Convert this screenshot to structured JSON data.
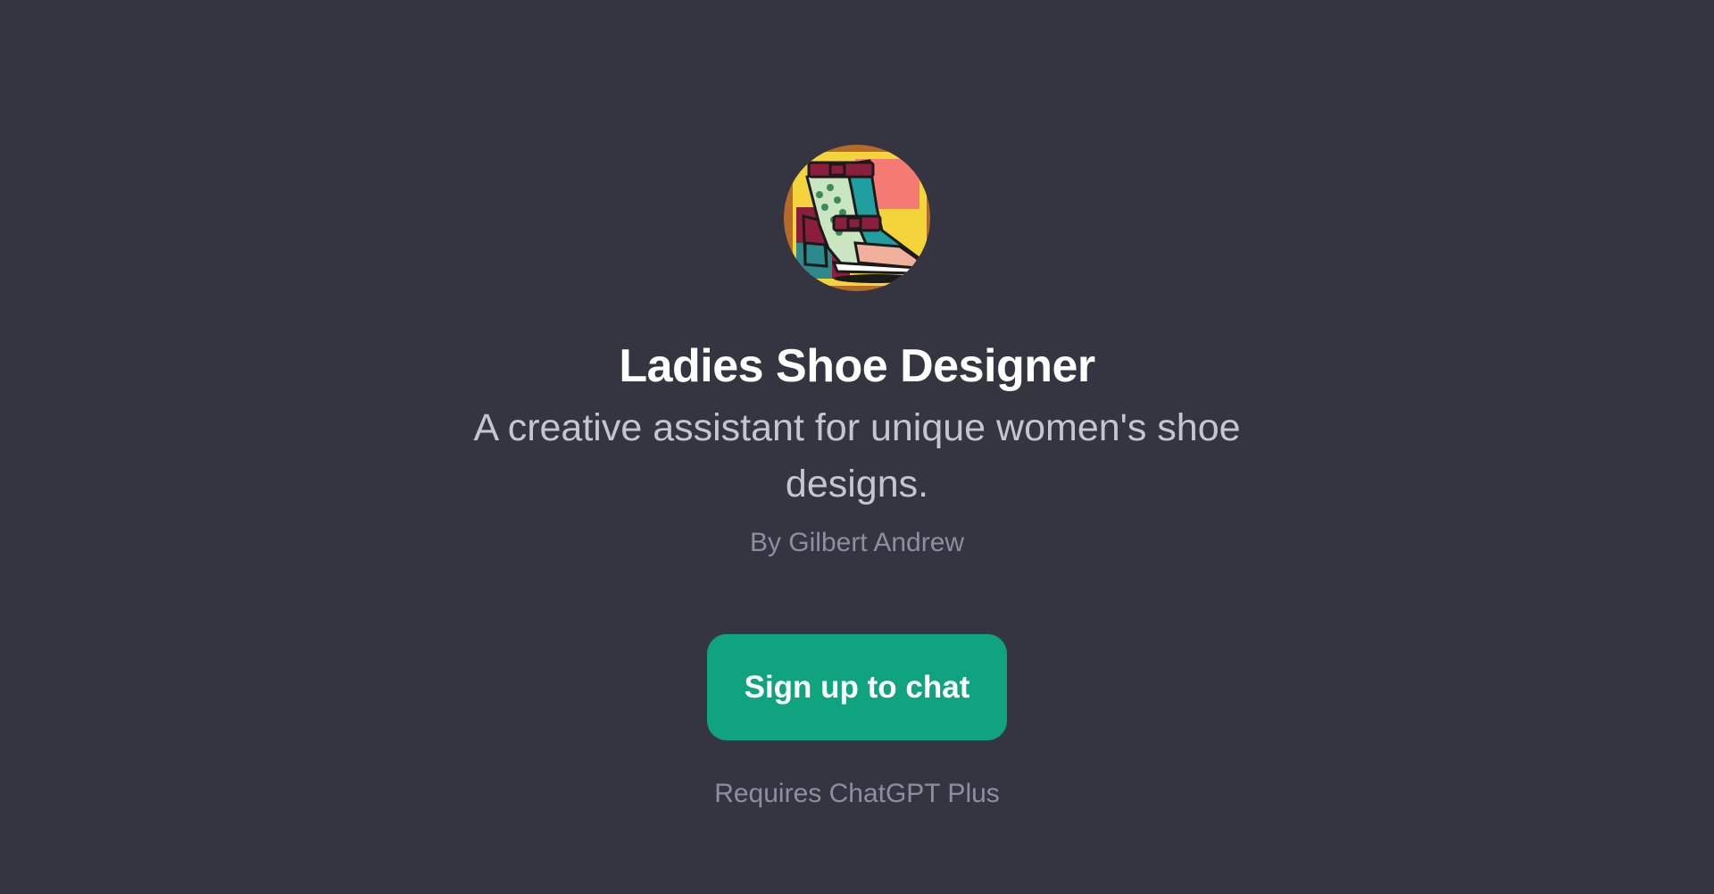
{
  "gpt": {
    "avatar_icon": "shoe-illustration-icon",
    "title": "Ladies Shoe Designer",
    "description": "A creative assistant for unique women's shoe designs.",
    "author": "By Gilbert Andrew"
  },
  "cta": {
    "signup_label": "Sign up to chat",
    "requirement": "Requires ChatGPT Plus"
  },
  "colors": {
    "background": "#343541",
    "title": "#ffffff",
    "description": "#c5c5d2",
    "muted": "#8e8ea0",
    "button": "#10a37f"
  }
}
